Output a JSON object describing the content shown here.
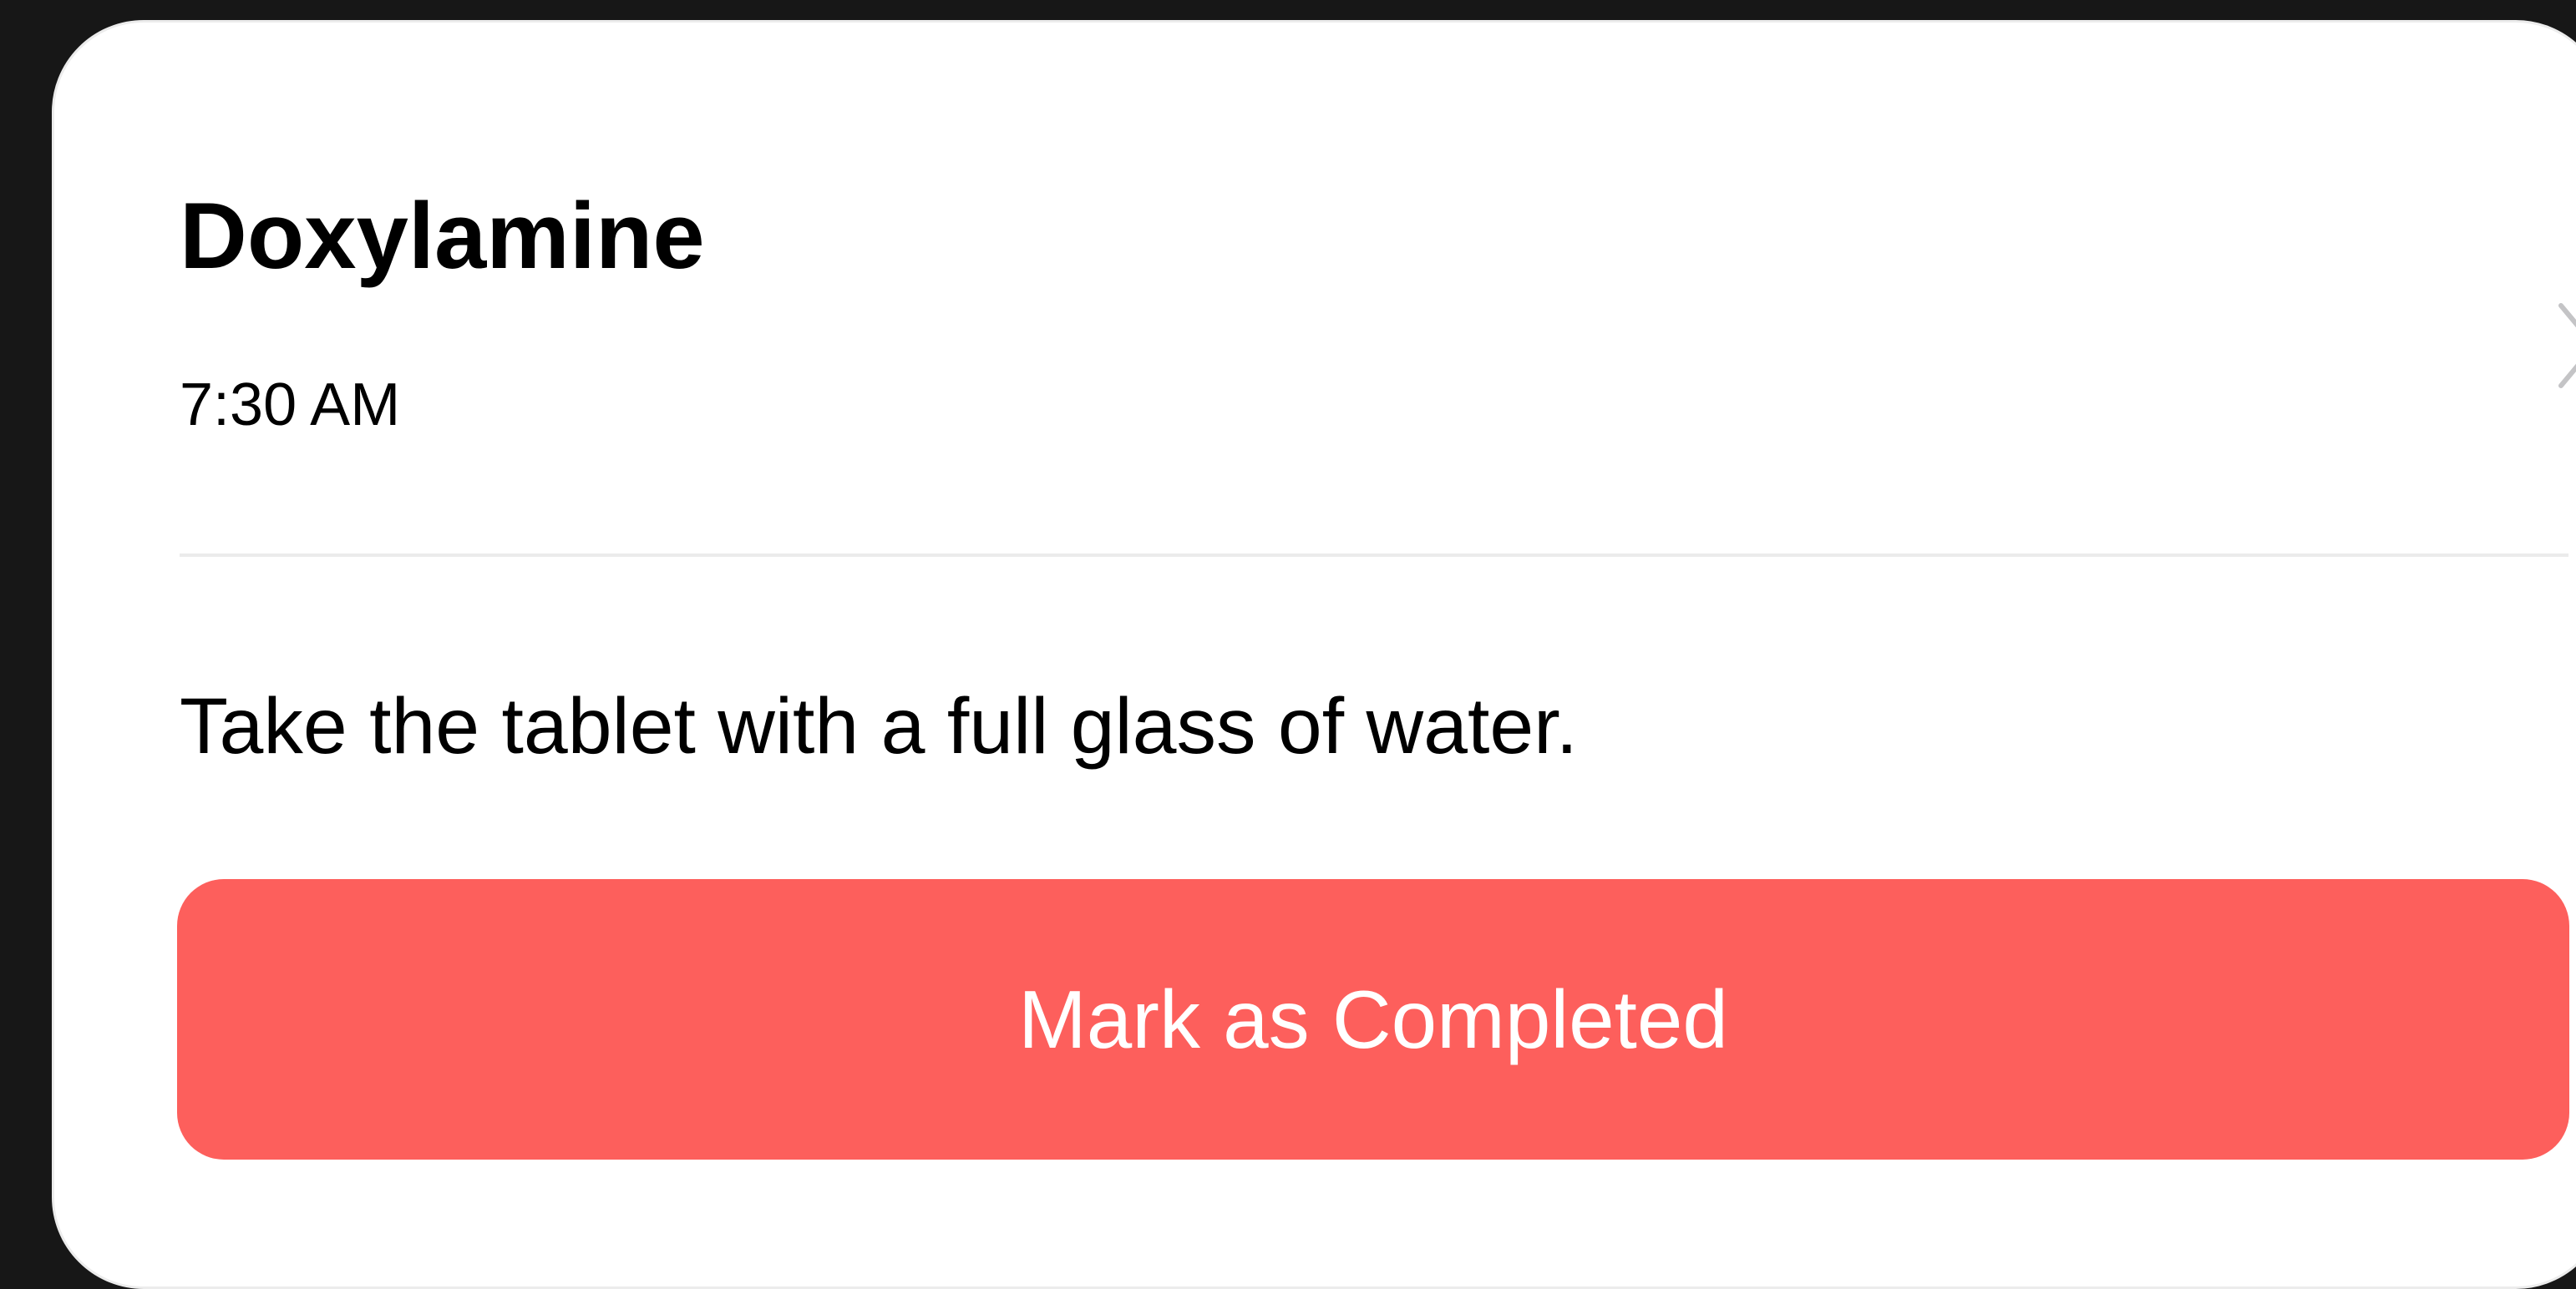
{
  "medication": {
    "name": "Doxylamine",
    "time": "7:30 AM",
    "instructions": "Take the tablet with a full glass of water."
  },
  "actions": {
    "complete_label": "Mark as Completed"
  },
  "icons": {
    "disclosure": "chevron-right-icon"
  },
  "colors": {
    "background": "#171717",
    "card": "#ffffff",
    "accent": "#fd5f5c",
    "chevron": "#c4c4c6",
    "divider": "#ebebeb"
  }
}
